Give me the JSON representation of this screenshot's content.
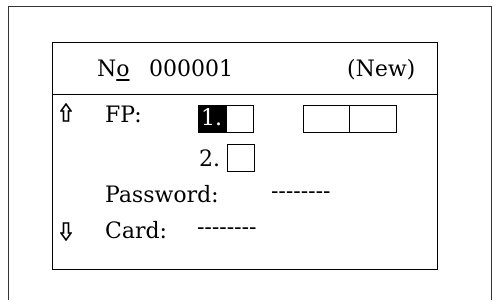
{
  "header": {
    "record_prefix": "No",
    "record_number": "000001",
    "status": "(New)"
  },
  "fields": {
    "fp_label": "FP:",
    "fp_slot1_label": "1.",
    "fp_slot2_label": "2.",
    "password_label": "Password:",
    "password_value": "--------",
    "card_label": "Card:",
    "card_value": "--------"
  },
  "icons": {
    "up": "up-arrow-icon",
    "down": "down-arrow-icon"
  }
}
